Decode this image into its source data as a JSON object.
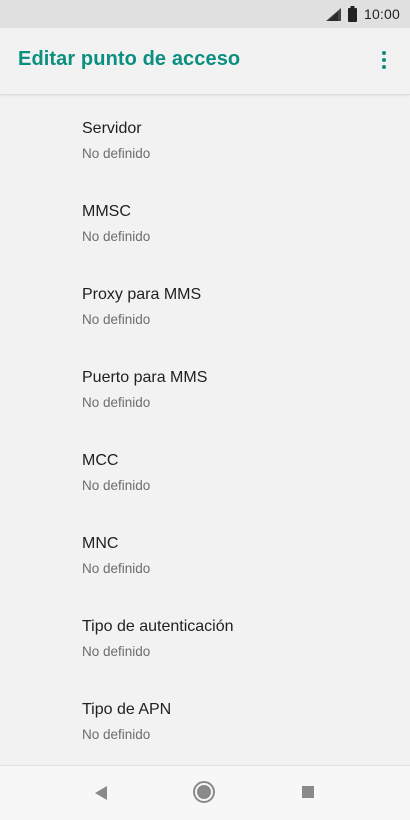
{
  "status_bar": {
    "time": "10:00",
    "icons": [
      "signal-icon",
      "battery-icon"
    ]
  },
  "app_bar": {
    "title": "Editar punto de acceso",
    "menu_icon": "more-vert-icon",
    "accent_color": "#0b8f7f"
  },
  "settings": [
    {
      "title": "Servidor",
      "summary": "No definido"
    },
    {
      "title": "MMSC",
      "summary": "No definido"
    },
    {
      "title": "Proxy para MMS",
      "summary": "No definido"
    },
    {
      "title": "Puerto para MMS",
      "summary": "No definido"
    },
    {
      "title": "MCC",
      "summary": "No definido"
    },
    {
      "title": "MNC",
      "summary": "No definido"
    },
    {
      "title": "Tipo de autenticación",
      "summary": "No definido"
    },
    {
      "title": "Tipo de APN",
      "summary": "No definido"
    }
  ],
  "nav_bar": {
    "icons": [
      "back-icon",
      "home-icon",
      "recents-icon"
    ]
  }
}
